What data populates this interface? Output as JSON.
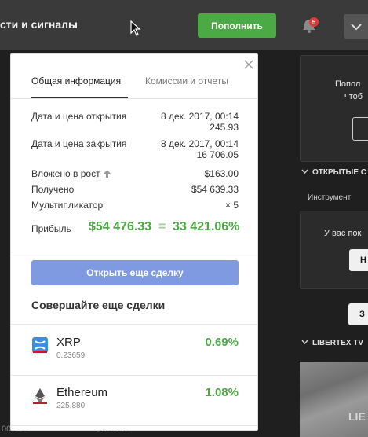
{
  "topbar": {
    "nav_title": "сти и сигналы",
    "deposit_label": "Пополнить",
    "notification_count": "5"
  },
  "background": {
    "bottom_left_1": "000.00",
    "bottom_left_2": "$493.43"
  },
  "right_panel": {
    "card1_line1": "Попол",
    "card1_line2": "чтоб",
    "card1_btn": "",
    "section_open": "ОТКРЫТЫЕ С",
    "column_instrument": "Инструмент",
    "card2_text": "У вас пок",
    "card2_btn": "Н",
    "card2_btn2": "З",
    "section_tv": "LIBERTEX TV",
    "video_label": "LIE"
  },
  "modal": {
    "tabs": [
      {
        "label": "Общая информация",
        "active": true
      },
      {
        "label": "Комиссии и отчеты",
        "active": false
      }
    ],
    "rows": {
      "open_label": "Дата и цена открытия",
      "open_date": "8 дек. 2017, 00:14",
      "open_price": "245.93",
      "close_label": "Дата и цена закрытия",
      "close_date": "8 дек. 2017, 00:14",
      "close_price": "16 706.05",
      "invested_label": "Вложено в рост",
      "invested_value": "$163.00",
      "received_label": "Получено",
      "received_value": "$54 639.33",
      "multiplier_label": "Мультипликатор",
      "multiplier_value": "× 5"
    },
    "profit": {
      "label": "Прибыль",
      "amount": "$54 476.33",
      "equals": "=",
      "percent": "33 421.06%"
    },
    "open_again_label": "Открыть еще сделку",
    "more_trades_title": "Совершайте еще сделки",
    "assets": [
      {
        "name": "XRP",
        "price": "0.23659",
        "change": "0.69%",
        "icon": "xrp-icon"
      },
      {
        "name": "Ethereum",
        "price": "225.880",
        "change": "1.08%",
        "icon": "ethereum-icon"
      }
    ]
  },
  "colors": {
    "accent_green": "#4caa44",
    "button_blue": "#7f9ae0",
    "topbar_bg": "#3a3a3a",
    "badge_red": "#e53935"
  }
}
